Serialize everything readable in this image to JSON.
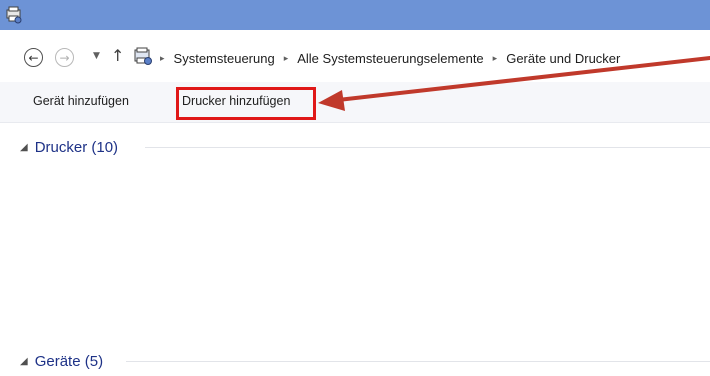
{
  "window": {
    "title_icon": "devices-printers-icon"
  },
  "navigation": {
    "back_icon": "←",
    "forward_icon": "→",
    "dropdown_icon": "▼",
    "up_icon": "↑"
  },
  "breadcrumb": {
    "separator": "▸",
    "items": [
      {
        "label": "Systemsteuerung"
      },
      {
        "label": "Alle Systemsteuerungselemente"
      },
      {
        "label": "Geräte und Drucker"
      }
    ]
  },
  "commandbar": {
    "add_device": "Gerät hinzufügen",
    "add_printer": "Drucker hinzufügen"
  },
  "groups": {
    "toggle_icon": "◢",
    "printers": "Drucker (10)",
    "devices": "Geräte (5)"
  },
  "colors": {
    "titlebar": "#6d93d6",
    "highlight": "#e01818",
    "arrow": "#c0392b",
    "group_label": "#1e3287"
  }
}
